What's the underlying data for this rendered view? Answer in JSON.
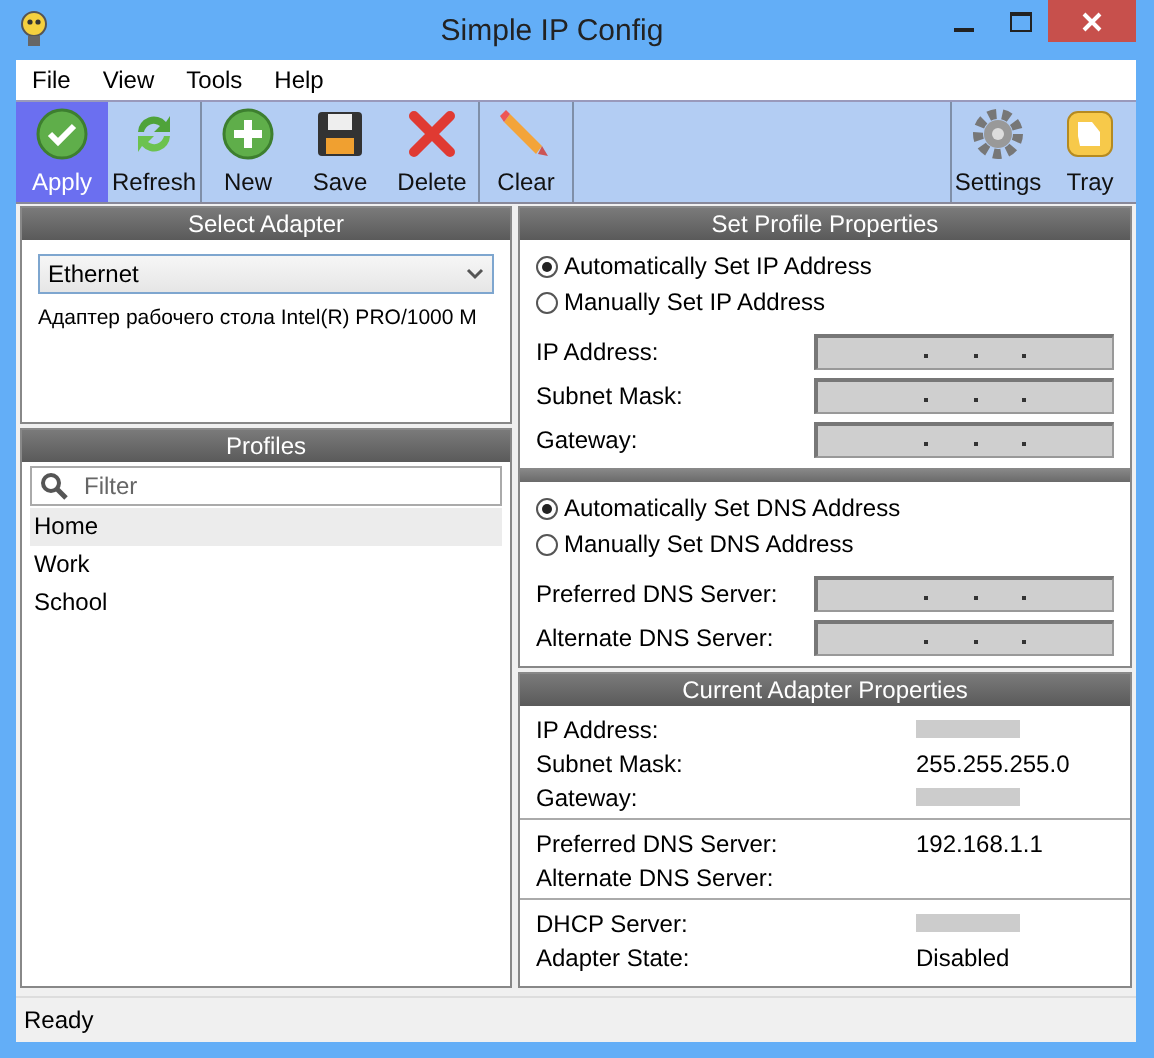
{
  "window": {
    "title": "Simple IP Config"
  },
  "menu": [
    "File",
    "View",
    "Tools",
    "Help"
  ],
  "toolbar": {
    "groups": [
      [
        {
          "label": "Apply",
          "kind": "check",
          "selected": true
        },
        {
          "label": "Refresh",
          "kind": "refresh",
          "selected": false
        }
      ],
      [
        {
          "label": "New",
          "kind": "plus",
          "selected": false
        },
        {
          "label": "Save",
          "kind": "disk",
          "selected": false
        },
        {
          "label": "Delete",
          "kind": "cross",
          "selected": false
        }
      ],
      [
        {
          "label": "Clear",
          "kind": "pencil",
          "selected": false
        }
      ],
      [
        {
          "label": "Settings",
          "kind": "gear",
          "selected": false
        },
        {
          "label": "Tray",
          "kind": "tray",
          "selected": false
        }
      ]
    ]
  },
  "select_adapter": {
    "title": "Select Adapter",
    "dropdown": {
      "value": "Ethernet"
    },
    "description": "Адаптер рабочего стола Intel(R) PRO/1000 M"
  },
  "profiles": {
    "title": "Profiles",
    "filter": {
      "placeholder": "Filter"
    },
    "items": [
      {
        "label": "Home",
        "selected": true
      },
      {
        "label": "Work",
        "selected": false
      },
      {
        "label": "School",
        "selected": false
      }
    ]
  },
  "set_profile": {
    "title": "Set Profile Properties",
    "ip_mode": [
      {
        "label": "Automatically Set IP Address",
        "selected": true
      },
      {
        "label": "Manually Set IP Address",
        "selected": false
      }
    ],
    "ip_fields": [
      {
        "label": "IP Address:"
      },
      {
        "label": "Subnet Mask:"
      },
      {
        "label": "Gateway:"
      }
    ],
    "dns_mode": [
      {
        "label": "Automatically Set DNS Address",
        "selected": true
      },
      {
        "label": "Manually Set DNS Address",
        "selected": false
      }
    ],
    "dns_fields": [
      {
        "label": "Preferred DNS Server:"
      },
      {
        "label": "Alternate DNS Server:"
      }
    ]
  },
  "current": {
    "title": "Current Adapter Properties",
    "groups": [
      [
        {
          "label": "IP Address:",
          "redacted": true
        },
        {
          "label": "Subnet Mask:",
          "value": "255.255.255.0"
        },
        {
          "label": "Gateway:",
          "redacted": true
        }
      ],
      [
        {
          "label": "Preferred DNS Server:",
          "value": "192.168.1.1"
        },
        {
          "label": "Alternate DNS Server:"
        }
      ],
      [
        {
          "label": "DHCP Server:",
          "redacted": true
        },
        {
          "label": "Adapter State:",
          "value": "Disabled"
        }
      ]
    ]
  },
  "status_bar": "Ready"
}
